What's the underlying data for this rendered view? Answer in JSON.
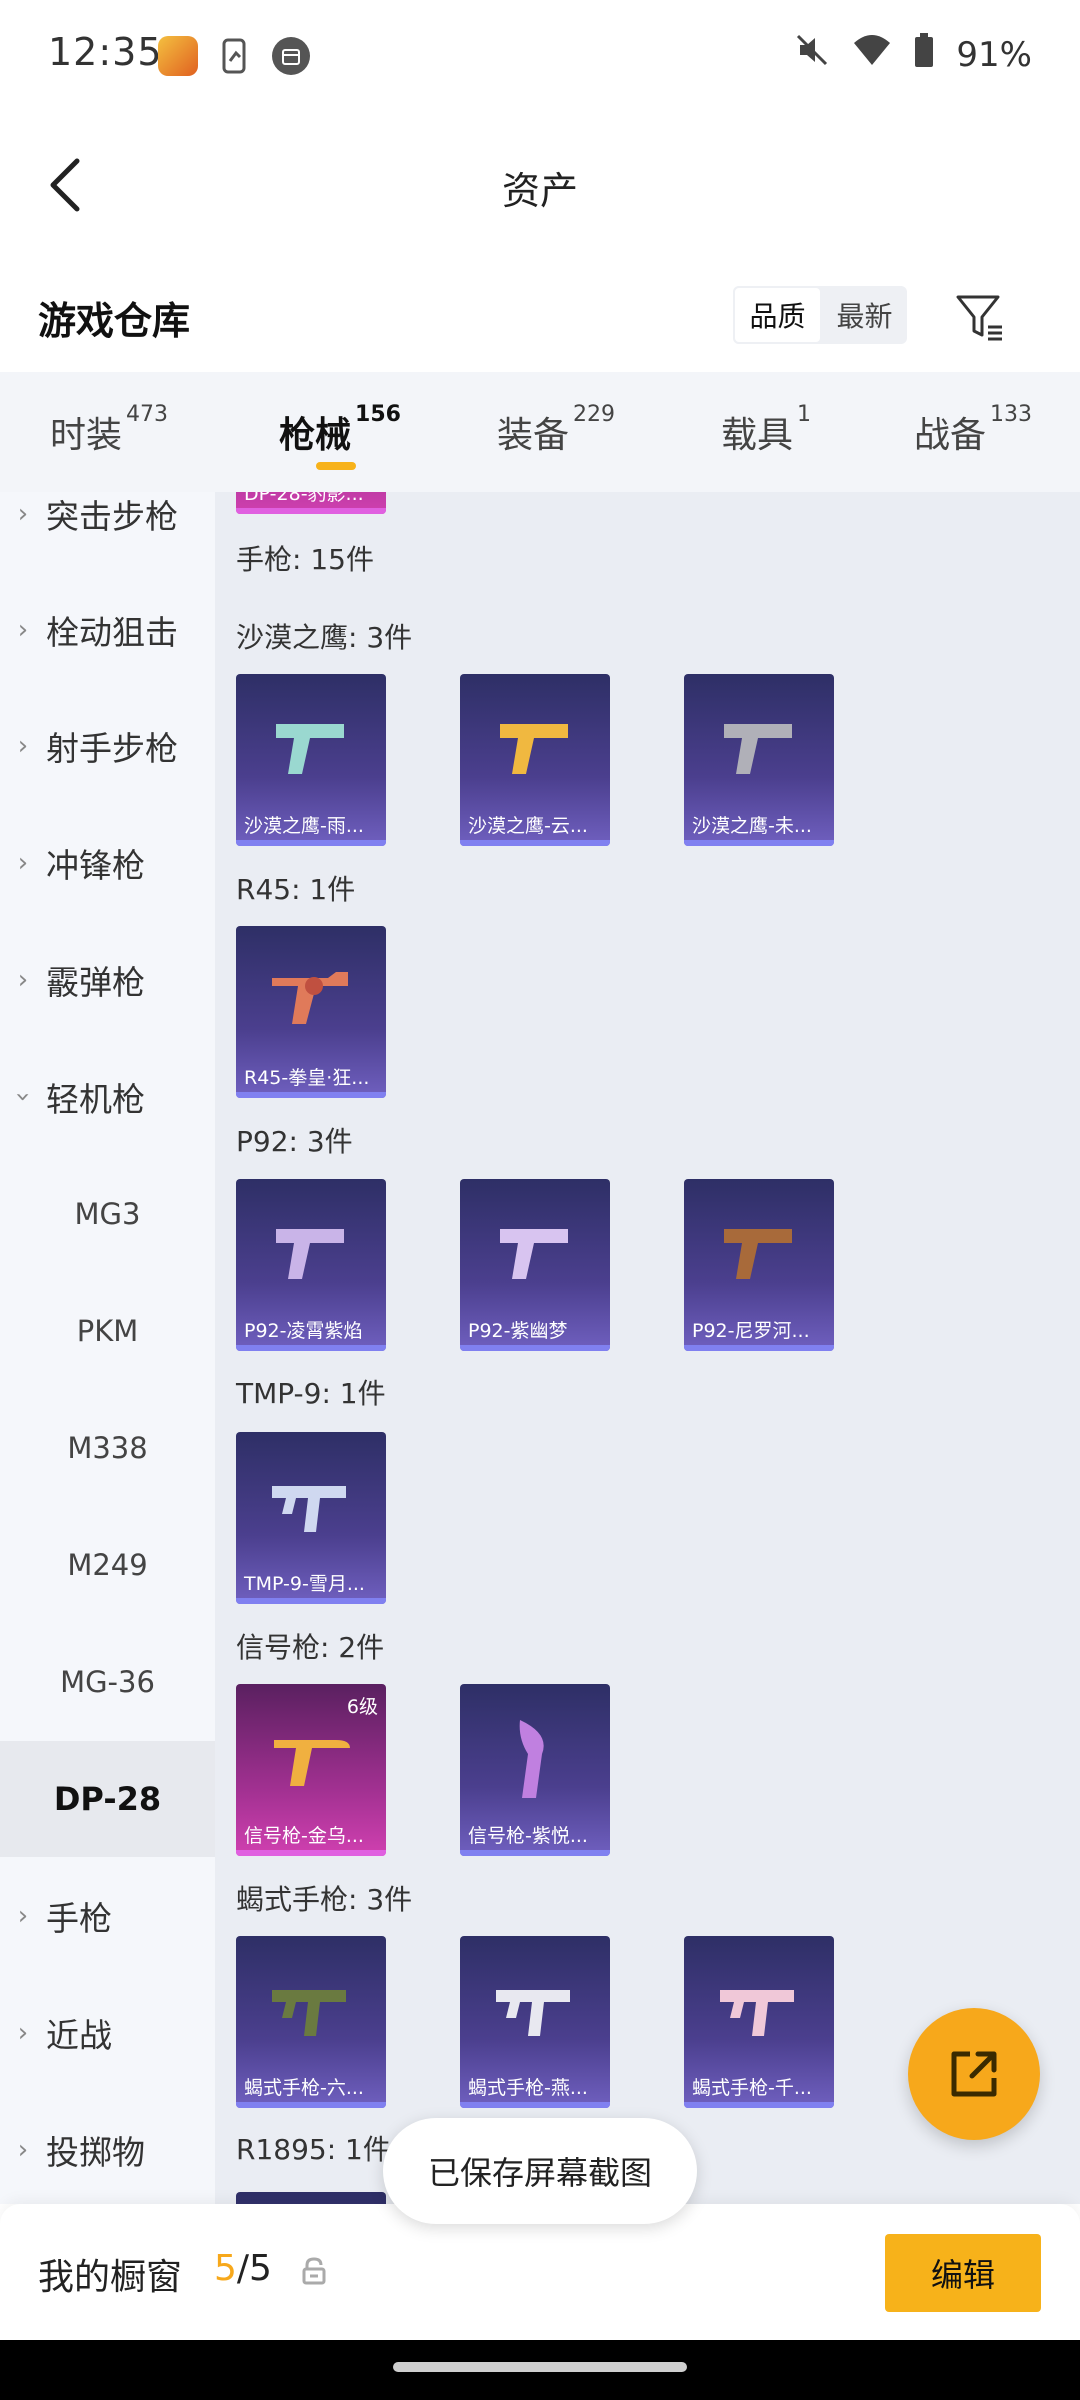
{
  "status_bar": {
    "time": "12:35",
    "battery": "91%",
    "icons": [
      "game-app-icon",
      "phone-icon",
      "calendar-icon",
      "mute-icon",
      "wifi-icon",
      "battery-icon"
    ]
  },
  "header": {
    "title": "资产",
    "back_icon": "chevron-left-icon"
  },
  "warehouse": {
    "title": "游戏仓库",
    "sort_options": [
      "品质",
      "最新"
    ],
    "selected_sort": "品质",
    "filter_icon": "filter-icon"
  },
  "tabs": [
    {
      "label": "时装",
      "count": "473"
    },
    {
      "label": "枪械",
      "count": "156"
    },
    {
      "label": "装备",
      "count": "229"
    },
    {
      "label": "载具",
      "count": "1"
    },
    {
      "label": "战备",
      "count": "133"
    }
  ],
  "active_tab": "枪械",
  "sidebar": {
    "categories": [
      "突击步枪",
      "栓动狙击",
      "射手步枪",
      "冲锋枪",
      "霰弹枪",
      "轻机枪"
    ],
    "subcategories": [
      "MG3",
      "PKM",
      "M338",
      "M249",
      "MG-36",
      "DP-28"
    ],
    "selected": "DP-28",
    "more_categories": [
      "手枪",
      "近战",
      "投掷物"
    ]
  },
  "content": {
    "partial_top_card": "DP-28-豹影...",
    "pistol_header": "手枪: 15件",
    "groups": [
      {
        "title": "沙漠之鹰: 3件",
        "items": [
          "沙漠之鹰-雨...",
          "沙漠之鹰-云...",
          "沙漠之鹰-未..."
        ]
      },
      {
        "title": "R45: 1件",
        "items": [
          "R45-拳皇·狂..."
        ]
      },
      {
        "title": "P92: 3件",
        "items": [
          "P92-凌霄紫焰",
          "P92-紫幽梦",
          "P92-尼罗河..."
        ]
      },
      {
        "title": "TMP-9: 1件",
        "items": [
          "TMP-9-雪月..."
        ]
      },
      {
        "title": "信号枪: 2件",
        "items": [
          "信号枪-金乌...",
          "信号枪-紫悦..."
        ],
        "first_level": "6级"
      },
      {
        "title": "蝎式手枪: 3件",
        "items": [
          "蝎式手枪-六...",
          "蝎式手枪-燕...",
          "蝎式手枪-千..."
        ]
      },
      {
        "title": "R1895: 1件",
        "items": []
      }
    ]
  },
  "fab_icon": "share-external-icon",
  "toast": "已保存屏幕截图",
  "bottom": {
    "showcase_label": "我的橱窗",
    "showcase_current": "5",
    "showcase_total": "/5",
    "lock_icon": "lock-icon",
    "edit_label": "编辑"
  }
}
